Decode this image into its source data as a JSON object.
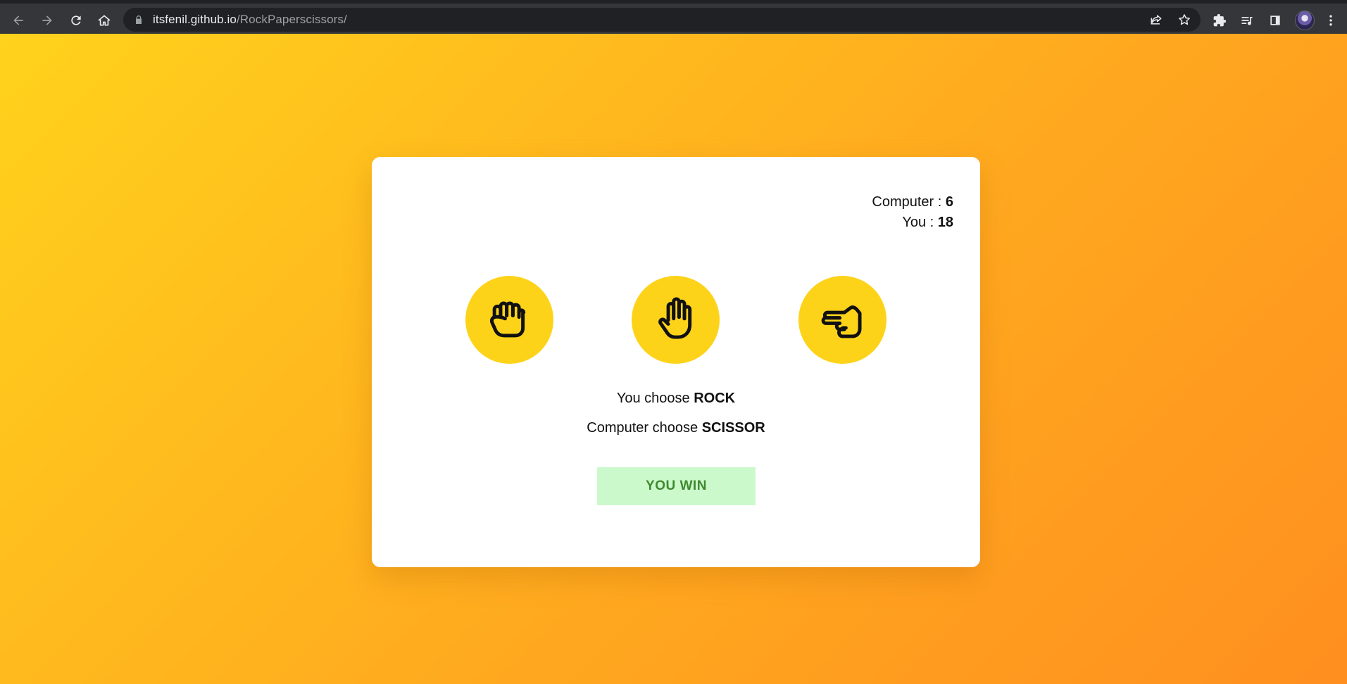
{
  "browser": {
    "url_host": "itsfenil.github.io",
    "url_path": "/RockPaperscissors/",
    "icons": [
      "back-icon",
      "forward-icon",
      "reload-icon",
      "home-icon",
      "lock-icon",
      "share-icon",
      "bookmark-star-icon",
      "extensions-icon",
      "reading-list-icon",
      "side-panel-icon",
      "profile-avatar",
      "more-menu-icon"
    ]
  },
  "scoreboard": {
    "computer_label": "Computer : ",
    "computer_score": "6",
    "you_label": "You : ",
    "you_score": "18"
  },
  "choices": [
    {
      "name": "rock",
      "icon": "fist-icon"
    },
    {
      "name": "paper",
      "icon": "open-hand-icon"
    },
    {
      "name": "scissors",
      "icon": "scissors-hand-icon"
    }
  ],
  "result": {
    "you_choose_label": "You choose ",
    "you_choice": "ROCK",
    "computer_choose_label": "Computer choose ",
    "computer_choice": "SCISSOR",
    "outcome": "YOU WIN"
  },
  "colors": {
    "gradient_start": "#ffd21c",
    "gradient_end": "#ff8f1f",
    "choice_circle": "#fdd31a",
    "win_banner_bg": "#ccf9cc",
    "win_banner_text": "#3f8a2e"
  }
}
